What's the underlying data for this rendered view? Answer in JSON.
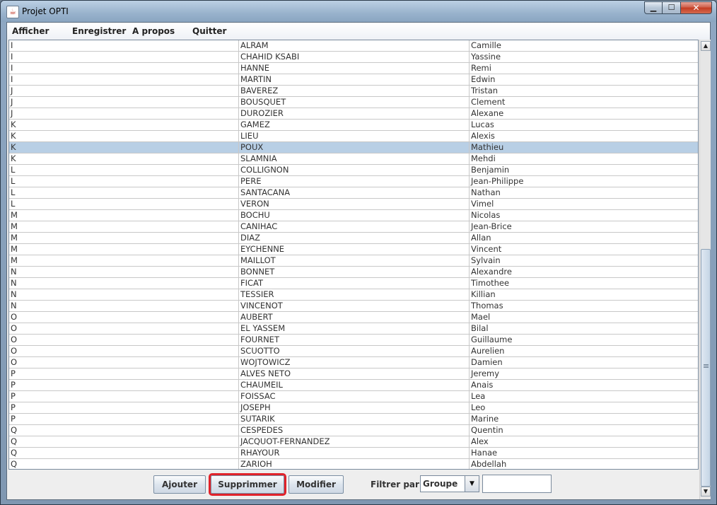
{
  "window": {
    "title": "Projet OPTI",
    "app_icon": "java-cup-icon"
  },
  "menu": [
    "Afficher",
    "Enregistrer",
    "A propos",
    "Quitter"
  ],
  "table": {
    "selected_index": 9,
    "rows": [
      [
        "I",
        "ALRAM",
        "Camille"
      ],
      [
        "I",
        "CHAHID KSABI",
        "Yassine"
      ],
      [
        "I",
        "HANNE",
        "Remi"
      ],
      [
        "I",
        "MARTIN",
        "Edwin"
      ],
      [
        "J",
        "BAVEREZ",
        "Tristan"
      ],
      [
        "J",
        "BOUSQUET",
        "Clement"
      ],
      [
        "J",
        "DUROZIER",
        "Alexane"
      ],
      [
        "K",
        "GAMEZ",
        "Lucas"
      ],
      [
        "K",
        "LIEU",
        "Alexis"
      ],
      [
        "K",
        "POUX",
        "Mathieu"
      ],
      [
        "K",
        "SLAMNIA",
        "Mehdi"
      ],
      [
        "L",
        "COLLIGNON",
        "Benjamin"
      ],
      [
        "L",
        "PERE",
        "Jean-Philippe"
      ],
      [
        "L",
        "SANTACANA",
        "Nathan"
      ],
      [
        "L",
        "VERON",
        "Vimel"
      ],
      [
        "M",
        "BOCHU",
        "Nicolas"
      ],
      [
        "M",
        "CANIHAC",
        "Jean-Brice"
      ],
      [
        "M",
        "DIAZ",
        "Allan"
      ],
      [
        "M",
        "EYCHENNE",
        "Vincent"
      ],
      [
        "M",
        "MAILLOT",
        "Sylvain"
      ],
      [
        "N",
        "BONNET",
        "Alexandre"
      ],
      [
        "N",
        "FICAT",
        "Timothee"
      ],
      [
        "N",
        "TESSIER",
        "Killian"
      ],
      [
        "N",
        "VINCENOT",
        "Thomas"
      ],
      [
        "O",
        "AUBERT",
        "Mael"
      ],
      [
        "O",
        "EL YASSEM",
        "Bilal"
      ],
      [
        "O",
        "FOURNET",
        "Guillaume"
      ],
      [
        "O",
        "SCUOTTO",
        "Aurelien"
      ],
      [
        "O",
        "WOJTOWICZ",
        "Damien"
      ],
      [
        "P",
        "ALVES NETO",
        "Jeremy"
      ],
      [
        "P",
        "CHAUMEIL",
        "Anais"
      ],
      [
        "P",
        "FOISSAC",
        "Lea"
      ],
      [
        "P",
        "JOSEPH",
        "Leo"
      ],
      [
        "P",
        "SUTARIK",
        "Marine"
      ],
      [
        "Q",
        "CESPEDES",
        "Quentin"
      ],
      [
        "Q",
        "JACQUOT-FERNANDEZ",
        "Alex"
      ],
      [
        "Q",
        "RHAYOUR",
        "Hanae"
      ],
      [
        "Q",
        "ZARIOH",
        "Abdellah"
      ]
    ]
  },
  "buttons": {
    "add": "Ajouter",
    "delete": "Supprimmer",
    "modify": "Modifier"
  },
  "filter": {
    "label": "Filtrer par :",
    "selected": "Groupe",
    "value": ""
  },
  "colors": {
    "selection": "#b8cfe5",
    "highlight": "#e0222a"
  }
}
